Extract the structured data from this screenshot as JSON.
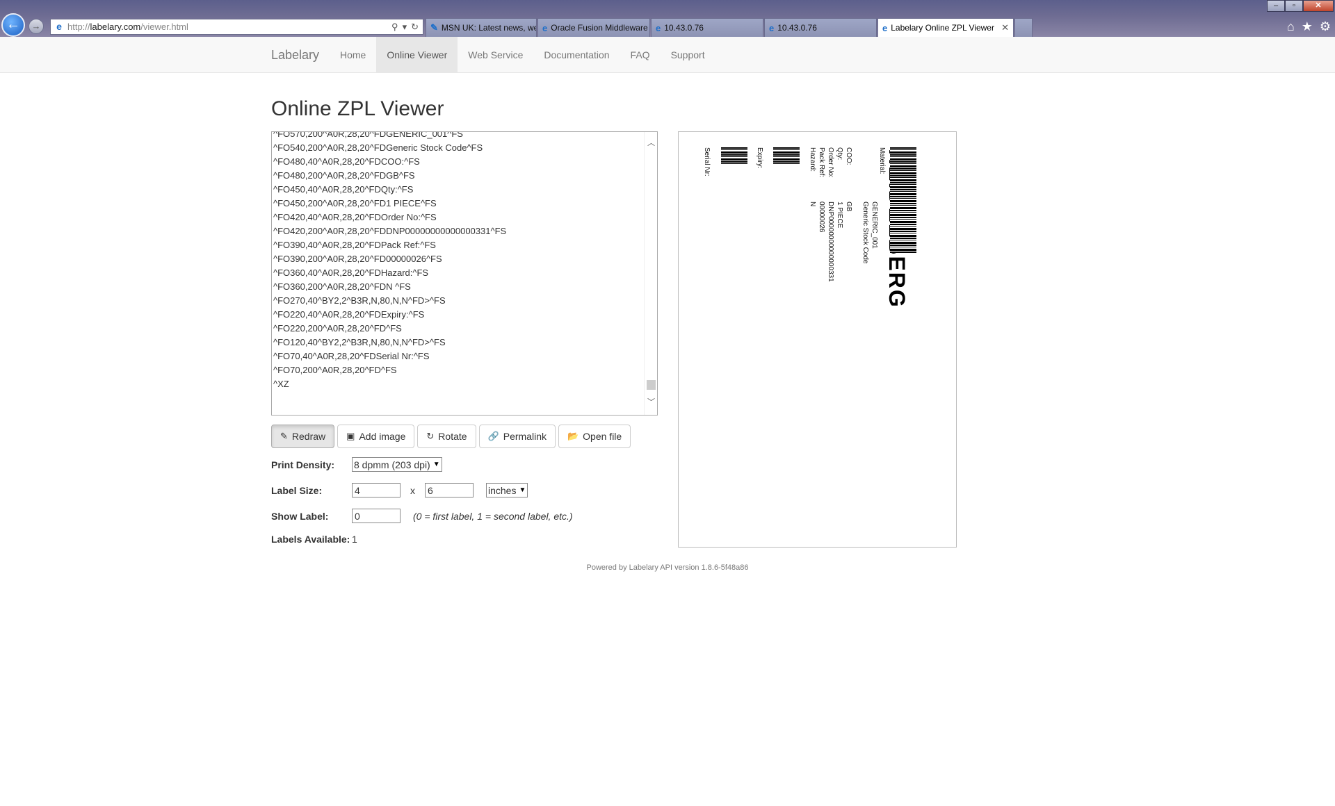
{
  "browser": {
    "url_prefix": "http://",
    "url_host": "labelary.com",
    "url_path": "/viewer.html",
    "tabs": [
      {
        "label": "MSN UK: Latest news, weather,...",
        "active": false
      },
      {
        "label": "Oracle Fusion Middleware For...",
        "active": false
      },
      {
        "label": "10.43.0.76",
        "active": false
      },
      {
        "label": "10.43.0.76",
        "active": false
      },
      {
        "label": "Labelary Online ZPL Viewer",
        "active": true
      }
    ]
  },
  "nav": {
    "brand": "Labelary",
    "items": [
      "Home",
      "Online Viewer",
      "Web Service",
      "Documentation",
      "FAQ",
      "Support"
    ]
  },
  "page_title": "Online ZPL Viewer",
  "zpl_lines": [
    "^FO570,200^A0R,28,20^FDGENERIC_001^FS",
    "^FO540,200^A0R,28,20^FDGeneric Stock Code^FS",
    "^FO480,40^A0R,28,20^FDCOO:^FS",
    "^FO480,200^A0R,28,20^FDGB^FS",
    "^FO450,40^A0R,28,20^FDQty:^FS",
    "^FO450,200^A0R,28,20^FD1 PIECE^FS",
    "^FO420,40^A0R,28,20^FDOrder No:^FS",
    "^FO420,200^A0R,28,20^FDDNP00000000000000331^FS",
    "^FO390,40^A0R,28,20^FDPack Ref:^FS",
    "^FO390,200^A0R,28,20^FD00000026^FS",
    "^FO360,40^A0R,28,20^FDHazard:^FS",
    "^FO360,200^A0R,28,20^FDN ^FS",
    "^FO270,40^BY2,2^B3R,N,80,N,N^FD>^FS",
    "^FO220,40^A0R,28,20^FDExpiry:^FS",
    "^FO220,200^A0R,28,20^FD^FS",
    "^FO120,40^BY2,2^B3R,N,80,N,N^FD>^FS",
    "^FO70,40^A0R,28,20^FDSerial Nr:^FS",
    "^FO70,200^A0R,28,20^FD^FS",
    "^XZ"
  ],
  "buttons": {
    "redraw": "Redraw",
    "add_image": "Add image",
    "rotate": "Rotate",
    "permalink": "Permalink",
    "open_file": "Open file"
  },
  "form": {
    "print_density_label": "Print Density:",
    "print_density_value": "8 dpmm (203 dpi)",
    "label_size_label": "Label Size:",
    "width": "4",
    "x_sep": "x",
    "height": "6",
    "unit": "inches",
    "show_label_label": "Show Label:",
    "show_label_value": "0",
    "show_label_hint": "(0 = first label, 1 = second label, etc.)",
    "labels_available_label": "Labels Available:",
    "labels_available_value": "1"
  },
  "label_preview": {
    "logo": "HEIDELBERG",
    "fields": {
      "material": "Material:",
      "generic_code": "GENERIC_001",
      "stock_code": "Generic Stock Code",
      "coo": "COO:",
      "coo_val": "GB",
      "qty": "Qty:",
      "qty_val": "1 PIECE",
      "order": "Order No:",
      "order_val": "DNP00000000000000331",
      "pack": "Pack Ref:",
      "pack_val": "00000026",
      "hazard": "Hazard:",
      "hazard_val": "N",
      "expiry": "Expiry:",
      "serial": "Serial Nr:"
    }
  },
  "footer": "Powered by Labelary API version 1.8.6-5f48a86"
}
